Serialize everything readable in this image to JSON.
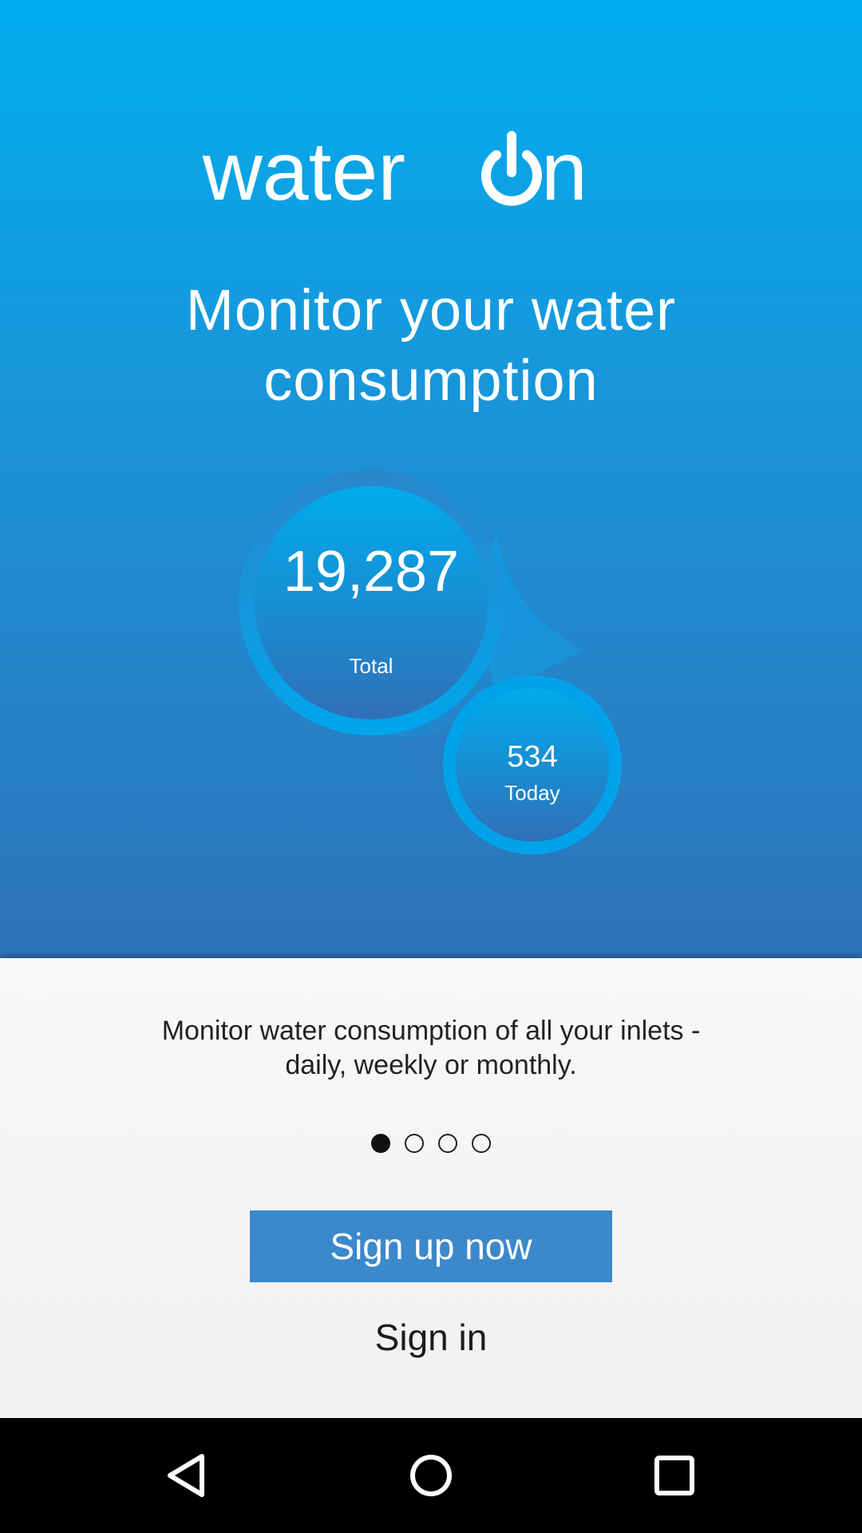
{
  "app": {
    "brand_prefix": "water",
    "brand_suffix": "n"
  },
  "hero": {
    "headline_line1": "Monitor your water",
    "headline_line2": "consumption"
  },
  "stats": {
    "total_value": "19,287",
    "total_label": "Total",
    "today_value": "534",
    "today_label": "Today"
  },
  "onboarding": {
    "description_line1": "Monitor water consumption of all your inlets -",
    "description_line2": "daily, weekly or monthly.",
    "page_count": 4,
    "active_page": 1
  },
  "actions": {
    "signup_label": "Sign up now",
    "signin_label": "Sign in"
  },
  "navbar": {
    "back_icon": "back-triangle-icon",
    "home_icon": "home-circle-icon",
    "recents_icon": "recents-square-icon"
  },
  "colors": {
    "hero_top": "#00aeef",
    "hero_bottom": "#2e73b9",
    "button": "#3b88cb",
    "bubble_ring": "#009fe8"
  }
}
